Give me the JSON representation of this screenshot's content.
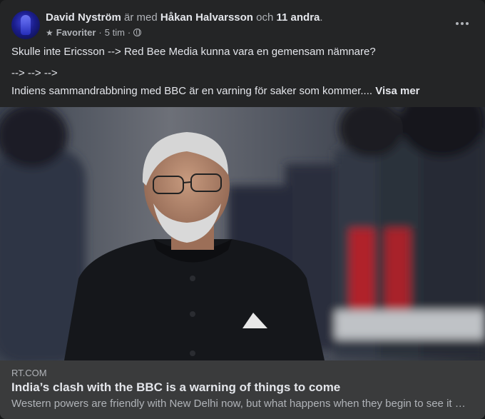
{
  "post": {
    "author": "David Nyström",
    "with_text": "är med",
    "tagged": "Håkan Halvarsson",
    "and_text": "och",
    "others": "11 andra",
    "end_punct": ".",
    "audience": "Favoriter",
    "time": "5 tim",
    "dot": "·",
    "line1": "Skulle inte Ericsson --> Red Bee Media kunna vara en gemensam nämnare?",
    "line2": "--> --> -->",
    "line3": "Indiens sammandrabbning med BBC är en varning för saker som kommer....",
    "see_more": "Visa mer"
  },
  "link": {
    "domain": "RT.COM",
    "headline": "India’s clash with the BBC is a warning of things to come",
    "description": "Western powers are friendly with New Delhi now, but what happens when they begin to see it …"
  },
  "icons": {
    "star": "star-icon",
    "globe": "globe-icon",
    "more": "more-options-icon"
  },
  "colors": {
    "card_bg": "#242526",
    "link_bg": "#3a3b3c",
    "text_primary": "#e4e6eb",
    "text_secondary": "#b0b3b8"
  }
}
